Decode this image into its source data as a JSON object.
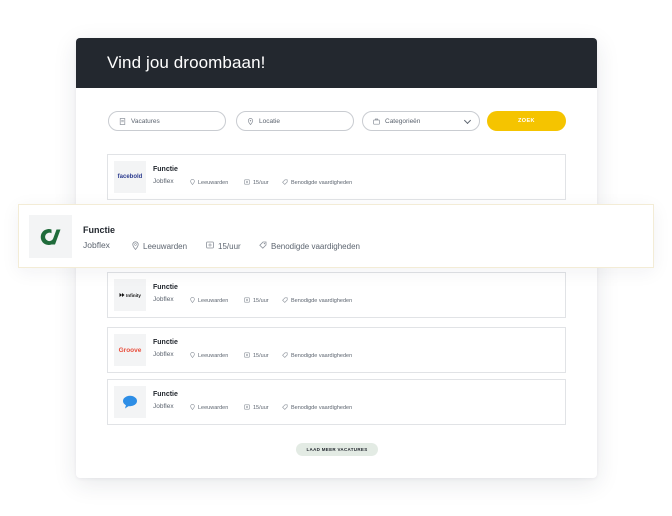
{
  "header": {
    "title": "Vind jou droombaan!"
  },
  "search": {
    "vacatures_placeholder": "Vacatures",
    "locatie_placeholder": "Locatie",
    "categorieen_label": "Categorieën",
    "submit_label": "ZOEK"
  },
  "jobs": [
    {
      "logo_text": "facebold",
      "logo_color": "#2b3b8f",
      "title": "Functie",
      "company": "Jobflex",
      "location": "Leeuwarden",
      "salary": "15/uur",
      "skills": "Benodigde vaardigheden"
    },
    {
      "logo_text": "",
      "logo_color": "#1f6b3a",
      "title": "Functie",
      "company": "Jobflex",
      "location": "Leeuwarden",
      "salary": "15/uur",
      "skills": "Benodigde vaardigheden"
    },
    {
      "logo_text": "Infinity",
      "logo_color": "#111111",
      "title": "Functie",
      "company": "Jobflex",
      "location": "Leeuwarden",
      "salary": "15/uur",
      "skills": "Benodigde vaardigheden"
    },
    {
      "logo_text": "Groove",
      "logo_color": "#e94e3c",
      "title": "Functie",
      "company": "Jobflex",
      "location": "Leeuwarden",
      "salary": "15/uur",
      "skills": "Benodigde vaardigheden"
    },
    {
      "logo_text": "",
      "logo_color": "#2e8ee6",
      "title": "Functie",
      "company": "Jobflex",
      "location": "Leeuwarden",
      "salary": "15/uur",
      "skills": "Benodigde vaardigheden"
    }
  ],
  "load_more_label": "LAAD MEER VACATURES",
  "colors": {
    "header_bg": "#23282f",
    "accent_yellow": "#f5c400",
    "load_more_bg": "#e3ebe4"
  }
}
